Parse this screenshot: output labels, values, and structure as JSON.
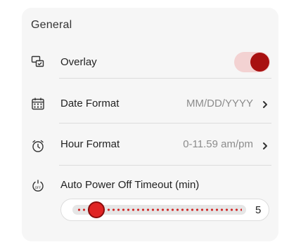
{
  "section": {
    "title": "General"
  },
  "overlay": {
    "label": "Overlay",
    "icon": "overlay-display-icon",
    "enabled": true
  },
  "date_format": {
    "label": "Date Format",
    "icon": "calendar-icon",
    "value": "MM/DD/YYYY"
  },
  "hour_format": {
    "label": "Hour Format",
    "icon": "clock-icon",
    "value": "0-11.59 am/pm"
  },
  "auto_power_off": {
    "label": "Auto Power Off Timeout (min)",
    "icon": "power-off-timer-icon",
    "value": "5",
    "slider_fraction": 0.1
  },
  "colors": {
    "accent": "#a81010",
    "toggle_track": "#f3d2d2",
    "slider_thumb": "#e02424",
    "card_bg": "#f6f6f6",
    "muted_text": "#8c8c8c"
  }
}
